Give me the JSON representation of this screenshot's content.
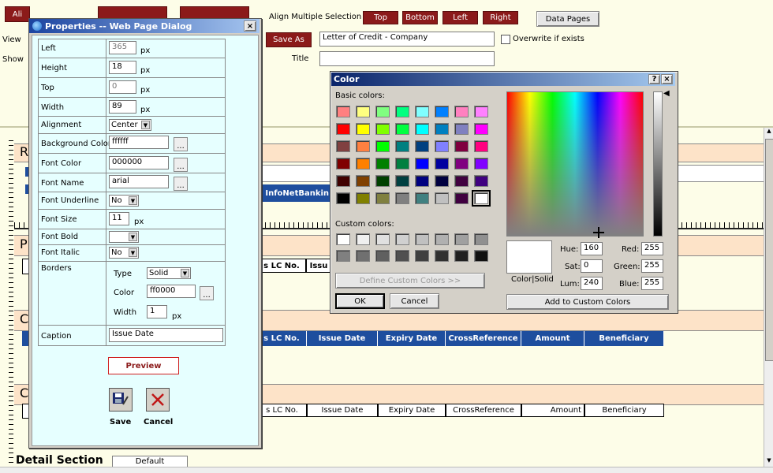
{
  "toolbar": {
    "left_clip": "Ali",
    "view_label": "View",
    "show_label": "Show",
    "align_multiple_label": "Align Multiple Selection",
    "align_buttons": [
      "Top",
      "Bottom",
      "Left",
      "Right"
    ],
    "data_pages_label": "Data Pages",
    "save_as_label": "Save As",
    "save_as_value": "Letter of Credit - Company",
    "overwrite_label": "Overwrite if exists",
    "title_label": "Title",
    "title_value": ""
  },
  "designer": {
    "section_letters": [
      "R",
      "P",
      "C",
      "C"
    ],
    "banner_text": "o InfoNetBankin",
    "header_cells": [
      "s LC No.",
      "Issue Date",
      "Expiry Date",
      "CrossReference",
      "Amount",
      "Beneficiary"
    ],
    "top_fragment_cells": [
      "s LC No.",
      "Issu"
    ],
    "row_cells": [
      "s LC No.",
      "Issue Date",
      "Expiry Date",
      "CrossReference",
      "Amount",
      "Beneficiary"
    ],
    "detail_section_label": "Detail Section",
    "detail_default": "Default",
    "colors": {
      "header_blue": "#1e4e9e",
      "band_peach": "#fde3c8",
      "page_bg": "#fdfde8"
    }
  },
  "properties": {
    "title": "Properties -- Web Page Dialog",
    "close": "×",
    "fields": {
      "left_label": "Left",
      "left_value": "365",
      "height_label": "Height",
      "height_value": "18",
      "top_label": "Top",
      "top_value": "0",
      "width_label": "Width",
      "width_value": "89",
      "unit": "px",
      "alignment_label": "Alignment",
      "alignment_value": "Center",
      "bg_color_label": "Background Color",
      "bg_color_value": "ffffff",
      "font_color_label": "Font Color",
      "font_color_value": "000000",
      "font_name_label": "Font Name",
      "font_name_value": "arial",
      "font_underline_label": "Font Underline",
      "font_underline_value": "No",
      "font_size_label": "Font Size",
      "font_size_value": "11",
      "font_bold_label": "Font Bold",
      "font_bold_value": "",
      "font_italic_label": "Font Italic",
      "font_italic_value": "No",
      "borders_label": "Borders",
      "type_label": "Type",
      "type_value": "Solid",
      "color_label": "Color",
      "color_value": "ff0000",
      "border_width_label": "Width",
      "border_width_value": "1",
      "caption_label": "Caption",
      "caption_value": "Issue Date",
      "ellipsis": "..."
    },
    "preview_label": "Preview",
    "save_label": "Save",
    "cancel_label": "Cancel"
  },
  "color_dialog": {
    "title": "Color",
    "help": "?",
    "close": "×",
    "basic_label": "Basic colors:",
    "custom_label": "Custom colors:",
    "define_label": "Define Custom Colors >>",
    "ok_label": "OK",
    "cancel_label": "Cancel",
    "add_label": "Add to Custom Colors",
    "color_solid_label": "Color|Solid",
    "hue_label": "Hue:",
    "hue_value": "160",
    "sat_label": "Sat:",
    "sat_value": "0",
    "lum_label": "Lum:",
    "lum_value": "240",
    "red_label": "Red:",
    "red_value": "255",
    "green_label": "Green:",
    "green_value": "255",
    "blue_label": "Blue:",
    "blue_value": "255",
    "basic_colors": [
      "#ff8080",
      "#ffff80",
      "#80ff80",
      "#00ff80",
      "#80ffff",
      "#0080ff",
      "#ff80c0",
      "#ff80ff",
      "#ff0000",
      "#ffff00",
      "#80ff00",
      "#00ff40",
      "#00ffff",
      "#0080c0",
      "#8080c0",
      "#ff00ff",
      "#804040",
      "#ff8040",
      "#00ff00",
      "#008080",
      "#004080",
      "#8080ff",
      "#800040",
      "#ff0080",
      "#800000",
      "#ff8000",
      "#008000",
      "#008040",
      "#0000ff",
      "#0000a0",
      "#800080",
      "#8000ff",
      "#400000",
      "#804000",
      "#004000",
      "#004040",
      "#000080",
      "#000040",
      "#400040",
      "#400080",
      "#000000",
      "#808000",
      "#808040",
      "#808080",
      "#408080",
      "#c0c0c0",
      "#400040",
      "#ffffff"
    ],
    "custom_colors": [
      "#ffffff",
      "#f0f0f0",
      "#e0e0e0",
      "#d0d0d0",
      "#c0c0c0",
      "#b0b0b0",
      "#a0a0a0",
      "#909090",
      "#808080",
      "#707070",
      "#606060",
      "#505050",
      "#404040",
      "#303030",
      "#202020",
      "#101010"
    ]
  }
}
